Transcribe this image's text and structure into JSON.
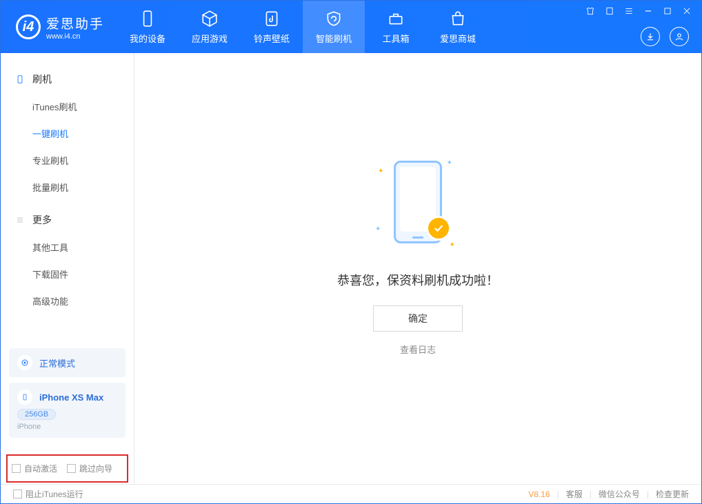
{
  "app": {
    "name": "爱思助手",
    "site": "www.i4.cn"
  },
  "nav": {
    "tabs": [
      {
        "label": "我的设备"
      },
      {
        "label": "应用游戏"
      },
      {
        "label": "铃声壁纸"
      },
      {
        "label": "智能刷机"
      },
      {
        "label": "工具箱"
      },
      {
        "label": "爱思商城"
      }
    ]
  },
  "sidebar": {
    "section1": {
      "title": "刷机"
    },
    "items1": [
      {
        "label": "iTunes刷机"
      },
      {
        "label": "一键刷机"
      },
      {
        "label": "专业刷机"
      },
      {
        "label": "批量刷机"
      }
    ],
    "section2": {
      "title": "更多"
    },
    "items2": [
      {
        "label": "其他工具"
      },
      {
        "label": "下载固件"
      },
      {
        "label": "高级功能"
      }
    ]
  },
  "mode_card": {
    "label": "正常模式"
  },
  "device_card": {
    "name": "iPhone XS Max",
    "capacity": "256GB",
    "type": "iPhone"
  },
  "checkboxes": {
    "auto_activate": "自动激活",
    "skip_guide": "跳过向导"
  },
  "main": {
    "success_msg": "恭喜您，保资料刷机成功啦！",
    "ok_label": "确定",
    "log_link": "查看日志"
  },
  "status": {
    "block_itunes": "阻止iTunes运行",
    "version": "V8.16",
    "links": {
      "support": "客服",
      "wechat": "微信公众号",
      "update": "检查更新"
    }
  }
}
